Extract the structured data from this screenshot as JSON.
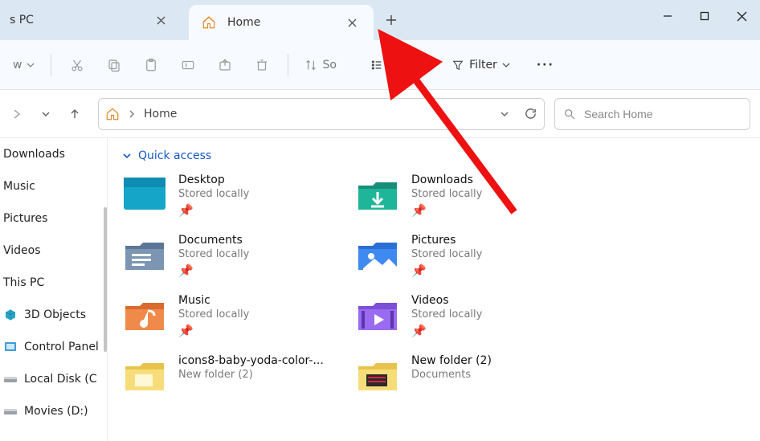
{
  "tabs": [
    {
      "title": "s PC"
    },
    {
      "title": "Home"
    }
  ],
  "addressbar": {
    "crumb": "Home"
  },
  "toolbar": {
    "view_label": "View",
    "sort_label": "So",
    "filter_label": "Filter",
    "new_suffix": "w"
  },
  "search": {
    "placeholder": "Search Home"
  },
  "sidebar": {
    "items": [
      {
        "label": "Downloads"
      },
      {
        "label": "Music"
      },
      {
        "label": "Pictures"
      },
      {
        "label": "Videos"
      },
      {
        "label": "This PC"
      },
      {
        "label": "3D Objects"
      },
      {
        "label": "Control Panel"
      },
      {
        "label": "Local Disk (C"
      },
      {
        "label": "Movies (D:)"
      }
    ]
  },
  "group": {
    "title": "Quick access"
  },
  "items": [
    {
      "title": "Desktop",
      "sub": "Stored locally",
      "pin": true,
      "color": "desktop"
    },
    {
      "title": "Downloads",
      "sub": "Stored locally",
      "pin": true,
      "color": "downloads"
    },
    {
      "title": "Documents",
      "sub": "Stored locally",
      "pin": true,
      "color": "documents"
    },
    {
      "title": "Pictures",
      "sub": "Stored locally",
      "pin": true,
      "color": "pictures"
    },
    {
      "title": "Music",
      "sub": "Stored locally",
      "pin": true,
      "color": "music"
    },
    {
      "title": "Videos",
      "sub": "Stored locally",
      "pin": true,
      "color": "videos"
    },
    {
      "title": "icons8-baby-yoda-color-...",
      "sub": "New folder (2)",
      "pin": false,
      "color": "folder"
    },
    {
      "title": "New folder (2)",
      "sub": "Documents",
      "pin": false,
      "color": "folder2"
    }
  ]
}
